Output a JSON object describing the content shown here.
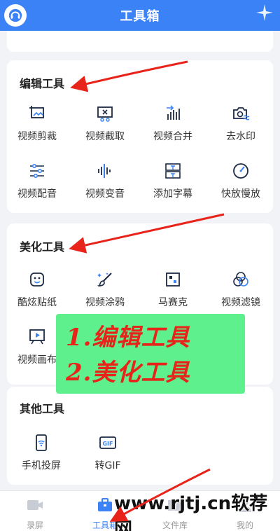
{
  "header": {
    "title": "工具箱"
  },
  "edit_section": {
    "title": "编辑工具",
    "tools": [
      {
        "label": "视频剪裁",
        "icon": "crop-image-icon"
      },
      {
        "label": "视频截取",
        "icon": "scissors-clip-icon"
      },
      {
        "label": "视频合并",
        "icon": "merge-bars-icon"
      },
      {
        "label": "去水印",
        "icon": "camera-wave-icon"
      },
      {
        "label": "视频配音",
        "icon": "sliders-icon"
      },
      {
        "label": "视频变音",
        "icon": "soundwave-icon"
      },
      {
        "label": "添加字幕",
        "icon": "subtitle-icon"
      },
      {
        "label": "快放慢放",
        "icon": "speed-dial-icon"
      }
    ]
  },
  "beauty_section": {
    "title": "美化工具",
    "tools": [
      {
        "label": "酷炫贴纸",
        "icon": "sticker-face-icon"
      },
      {
        "label": "视频涂鸦",
        "icon": "paintbrush-icon"
      },
      {
        "label": "马赛克",
        "icon": "mosaic-icon"
      },
      {
        "label": "视频滤镜",
        "icon": "filter-circles-icon"
      },
      {
        "label": "视频画布",
        "icon": "canvas-play-icon"
      }
    ]
  },
  "other_section": {
    "title": "其他工具",
    "tools": [
      {
        "label": "手机投屏",
        "icon": "phone-cast-icon"
      },
      {
        "label": "转GIF",
        "icon": "gif-icon"
      }
    ]
  },
  "tabbar": {
    "tabs": [
      {
        "label": "录屏",
        "icon": "video-camera-icon"
      },
      {
        "label": "工具箱",
        "icon": "toolbox-icon",
        "active": true
      },
      {
        "label": "文件库",
        "icon": "folder-icon"
      },
      {
        "label": "我的",
        "icon": "user-icon"
      }
    ]
  },
  "overlay": {
    "line1": "1.编辑工具",
    "line2": "2.美化工具"
  },
  "watermark": "www.rjtj.cn软荐网",
  "colors": {
    "accent": "#3b82f6",
    "annotation_red": "#e8231a",
    "overlay_green": "#5ef08c"
  }
}
